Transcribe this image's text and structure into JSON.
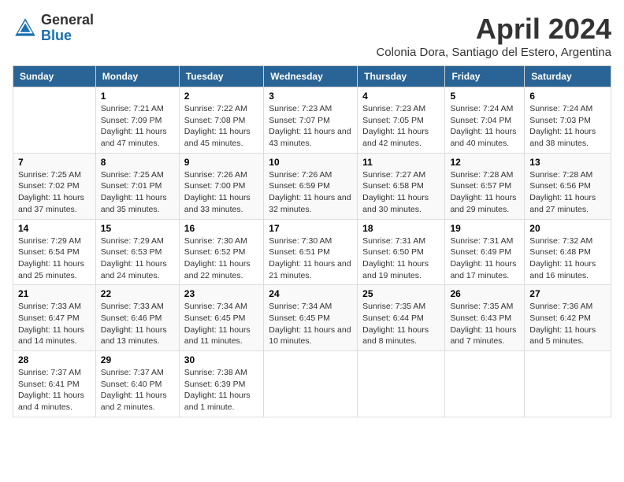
{
  "header": {
    "logo_general": "General",
    "logo_blue": "Blue",
    "month_title": "April 2024",
    "subtitle": "Colonia Dora, Santiago del Estero, Argentina"
  },
  "calendar": {
    "days_of_week": [
      "Sunday",
      "Monday",
      "Tuesday",
      "Wednesday",
      "Thursday",
      "Friday",
      "Saturday"
    ],
    "weeks": [
      [
        {
          "day": "",
          "sunrise": "",
          "sunset": "",
          "daylight": ""
        },
        {
          "day": "1",
          "sunrise": "Sunrise: 7:21 AM",
          "sunset": "Sunset: 7:09 PM",
          "daylight": "Daylight: 11 hours and 47 minutes."
        },
        {
          "day": "2",
          "sunrise": "Sunrise: 7:22 AM",
          "sunset": "Sunset: 7:08 PM",
          "daylight": "Daylight: 11 hours and 45 minutes."
        },
        {
          "day": "3",
          "sunrise": "Sunrise: 7:23 AM",
          "sunset": "Sunset: 7:07 PM",
          "daylight": "Daylight: 11 hours and 43 minutes."
        },
        {
          "day": "4",
          "sunrise": "Sunrise: 7:23 AM",
          "sunset": "Sunset: 7:05 PM",
          "daylight": "Daylight: 11 hours and 42 minutes."
        },
        {
          "day": "5",
          "sunrise": "Sunrise: 7:24 AM",
          "sunset": "Sunset: 7:04 PM",
          "daylight": "Daylight: 11 hours and 40 minutes."
        },
        {
          "day": "6",
          "sunrise": "Sunrise: 7:24 AM",
          "sunset": "Sunset: 7:03 PM",
          "daylight": "Daylight: 11 hours and 38 minutes."
        }
      ],
      [
        {
          "day": "7",
          "sunrise": "Sunrise: 7:25 AM",
          "sunset": "Sunset: 7:02 PM",
          "daylight": "Daylight: 11 hours and 37 minutes."
        },
        {
          "day": "8",
          "sunrise": "Sunrise: 7:25 AM",
          "sunset": "Sunset: 7:01 PM",
          "daylight": "Daylight: 11 hours and 35 minutes."
        },
        {
          "day": "9",
          "sunrise": "Sunrise: 7:26 AM",
          "sunset": "Sunset: 7:00 PM",
          "daylight": "Daylight: 11 hours and 33 minutes."
        },
        {
          "day": "10",
          "sunrise": "Sunrise: 7:26 AM",
          "sunset": "Sunset: 6:59 PM",
          "daylight": "Daylight: 11 hours and 32 minutes."
        },
        {
          "day": "11",
          "sunrise": "Sunrise: 7:27 AM",
          "sunset": "Sunset: 6:58 PM",
          "daylight": "Daylight: 11 hours and 30 minutes."
        },
        {
          "day": "12",
          "sunrise": "Sunrise: 7:28 AM",
          "sunset": "Sunset: 6:57 PM",
          "daylight": "Daylight: 11 hours and 29 minutes."
        },
        {
          "day": "13",
          "sunrise": "Sunrise: 7:28 AM",
          "sunset": "Sunset: 6:56 PM",
          "daylight": "Daylight: 11 hours and 27 minutes."
        }
      ],
      [
        {
          "day": "14",
          "sunrise": "Sunrise: 7:29 AM",
          "sunset": "Sunset: 6:54 PM",
          "daylight": "Daylight: 11 hours and 25 minutes."
        },
        {
          "day": "15",
          "sunrise": "Sunrise: 7:29 AM",
          "sunset": "Sunset: 6:53 PM",
          "daylight": "Daylight: 11 hours and 24 minutes."
        },
        {
          "day": "16",
          "sunrise": "Sunrise: 7:30 AM",
          "sunset": "Sunset: 6:52 PM",
          "daylight": "Daylight: 11 hours and 22 minutes."
        },
        {
          "day": "17",
          "sunrise": "Sunrise: 7:30 AM",
          "sunset": "Sunset: 6:51 PM",
          "daylight": "Daylight: 11 hours and 21 minutes."
        },
        {
          "day": "18",
          "sunrise": "Sunrise: 7:31 AM",
          "sunset": "Sunset: 6:50 PM",
          "daylight": "Daylight: 11 hours and 19 minutes."
        },
        {
          "day": "19",
          "sunrise": "Sunrise: 7:31 AM",
          "sunset": "Sunset: 6:49 PM",
          "daylight": "Daylight: 11 hours and 17 minutes."
        },
        {
          "day": "20",
          "sunrise": "Sunrise: 7:32 AM",
          "sunset": "Sunset: 6:48 PM",
          "daylight": "Daylight: 11 hours and 16 minutes."
        }
      ],
      [
        {
          "day": "21",
          "sunrise": "Sunrise: 7:33 AM",
          "sunset": "Sunset: 6:47 PM",
          "daylight": "Daylight: 11 hours and 14 minutes."
        },
        {
          "day": "22",
          "sunrise": "Sunrise: 7:33 AM",
          "sunset": "Sunset: 6:46 PM",
          "daylight": "Daylight: 11 hours and 13 minutes."
        },
        {
          "day": "23",
          "sunrise": "Sunrise: 7:34 AM",
          "sunset": "Sunset: 6:45 PM",
          "daylight": "Daylight: 11 hours and 11 minutes."
        },
        {
          "day": "24",
          "sunrise": "Sunrise: 7:34 AM",
          "sunset": "Sunset: 6:45 PM",
          "daylight": "Daylight: 11 hours and 10 minutes."
        },
        {
          "day": "25",
          "sunrise": "Sunrise: 7:35 AM",
          "sunset": "Sunset: 6:44 PM",
          "daylight": "Daylight: 11 hours and 8 minutes."
        },
        {
          "day": "26",
          "sunrise": "Sunrise: 7:35 AM",
          "sunset": "Sunset: 6:43 PM",
          "daylight": "Daylight: 11 hours and 7 minutes."
        },
        {
          "day": "27",
          "sunrise": "Sunrise: 7:36 AM",
          "sunset": "Sunset: 6:42 PM",
          "daylight": "Daylight: 11 hours and 5 minutes."
        }
      ],
      [
        {
          "day": "28",
          "sunrise": "Sunrise: 7:37 AM",
          "sunset": "Sunset: 6:41 PM",
          "daylight": "Daylight: 11 hours and 4 minutes."
        },
        {
          "day": "29",
          "sunrise": "Sunrise: 7:37 AM",
          "sunset": "Sunset: 6:40 PM",
          "daylight": "Daylight: 11 hours and 2 minutes."
        },
        {
          "day": "30",
          "sunrise": "Sunrise: 7:38 AM",
          "sunset": "Sunset: 6:39 PM",
          "daylight": "Daylight: 11 hours and 1 minute."
        },
        {
          "day": "",
          "sunrise": "",
          "sunset": "",
          "daylight": ""
        },
        {
          "day": "",
          "sunrise": "",
          "sunset": "",
          "daylight": ""
        },
        {
          "day": "",
          "sunrise": "",
          "sunset": "",
          "daylight": ""
        },
        {
          "day": "",
          "sunrise": "",
          "sunset": "",
          "daylight": ""
        }
      ]
    ]
  }
}
